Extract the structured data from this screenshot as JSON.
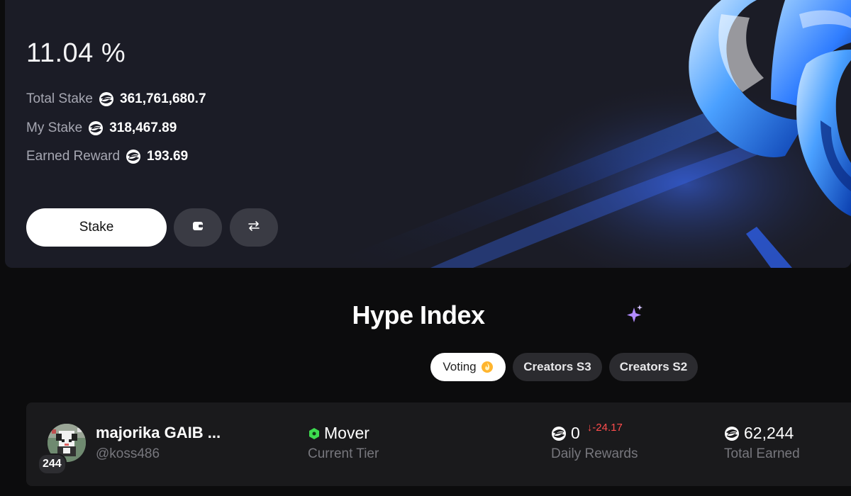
{
  "staking": {
    "apy": "11.04 %",
    "stats": [
      {
        "label": "Total Stake",
        "value": "361,761,680.7"
      },
      {
        "label": "My Stake",
        "value": "318,467.89"
      },
      {
        "label": "Earned Reward",
        "value": "193.69"
      }
    ],
    "stake_button": "Stake",
    "token_icon": "spiral-token-icon",
    "wallet_icon": "wallet-icon",
    "swap_icon": "swap-arrows-icon"
  },
  "hype": {
    "title": "Hype Index",
    "title_icon": "sparkle-icon",
    "tabs": [
      {
        "label": "Voting",
        "icon": "fire-emoji",
        "active": true
      },
      {
        "label": "Creators S3",
        "active": false
      },
      {
        "label": "Creators S2",
        "active": false
      }
    ]
  },
  "leaderboard": {
    "rows": [
      {
        "rank": "244",
        "name": "majorika GAIB ...",
        "handle": "@koss486",
        "tier": "Mover",
        "tier_label": "Current Tier",
        "daily_rewards": "0",
        "daily_change": "-24.17",
        "daily_label": "Daily Rewards",
        "total_earned": "62,244",
        "total_label": "Total Earned"
      }
    ]
  },
  "colors": {
    "card_bg": "#1b1c26",
    "accent_blue": "#2d6bff",
    "negative": "#ff4d4d",
    "tier_green": "#3ddc4f",
    "sparkle_purple": "#b28bff"
  }
}
